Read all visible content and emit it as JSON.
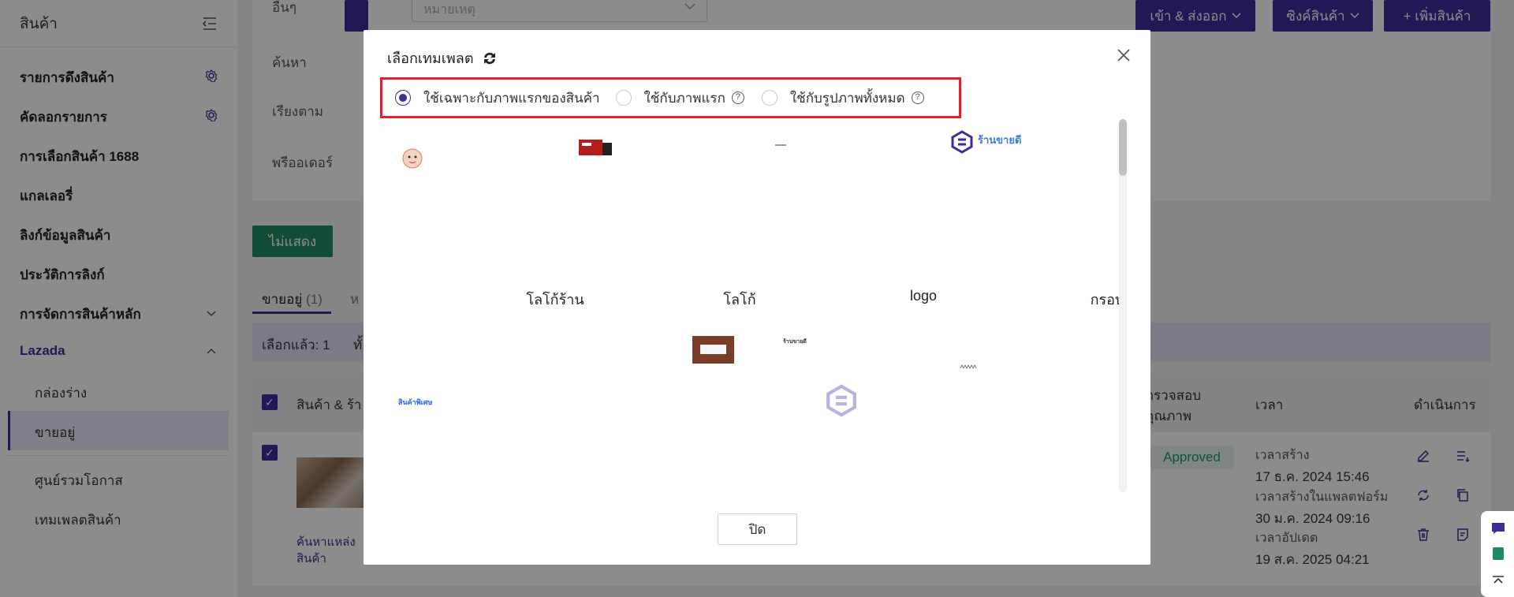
{
  "sidebar": {
    "title": "สินค้า",
    "items": [
      {
        "label": "รายการดึงสินค้า"
      },
      {
        "label": "คัดลอกรายการ"
      },
      {
        "label": "การเลือกสินค้า 1688"
      },
      {
        "label": "แกลเลอรี่"
      },
      {
        "label": "ลิงก์ข้อมูลสินค้า"
      },
      {
        "label": "ประวัติการลิงก์"
      },
      {
        "label": "การจัดการสินค้าหลัก"
      },
      {
        "label": "Lazada"
      }
    ],
    "sub_items": [
      {
        "label": "กล่องร่าง"
      },
      {
        "label": "ขายอยู่"
      },
      {
        "label": "ศูนย์รวมโอกาส"
      },
      {
        "label": "เทมเพลตสินค้า"
      }
    ]
  },
  "filters": {
    "other_label": "อื่นๆ",
    "other_placeholder": "หมายเหตุ",
    "search_label": "ค้นหา",
    "sort_label": "เรียงตาม",
    "preorder_label": "พรีออเดอร์"
  },
  "toolbar": {
    "hide_label": "ไม่แสดง",
    "import_export_label": "เข้า & ส่งออก",
    "sync_label": "ซิงค์สินค้า",
    "add_label": "+ เพิ่มสินค้า"
  },
  "tabs": {
    "active_label": "ขายอยู่",
    "active_count": "(1)",
    "next_partial": "ห"
  },
  "selection": {
    "text": "เลือกแล้ว: 1",
    "extra": "ทั้"
  },
  "table": {
    "col_product": "สินค้า & ร้า",
    "col_quality": "ตรวจสอบ",
    "col_quality2": "คุณภาพ",
    "col_time": "เวลา",
    "col_action": "ดำเนินการ",
    "row": {
      "source_link": "ค้นหาแหล่ง",
      "source_link2": "สินค้า",
      "status": "Approved",
      "created_label": "เวลาสร้าง",
      "created_value": "17 ธ.ค. 2024 15:46",
      "platform_created_label": "เวลาสร้างในแพลตฟอร์ม",
      "platform_created_value": "30 ม.ค. 2024 09:16",
      "updated_label": "เวลาอัปเดต",
      "updated_value": "19 ส.ค. 2025 04:21"
    }
  },
  "modal": {
    "title": "เลือกเทมเพลต",
    "options": [
      {
        "label": "ใช้เฉพาะกับภาพแรกของสินค้า",
        "selected": true
      },
      {
        "label": "ใช้กับภาพแรก",
        "selected": false
      },
      {
        "label": "ใช้กับรูปภาพทั้งหมด",
        "selected": false
      }
    ],
    "templates_row1": [
      "โลโก้ร้าน",
      "โลโก้",
      "logo",
      "กรอบ"
    ],
    "brand_text": "ร้านขายดี",
    "special_text": "สินค้าพิเศษ",
    "shop_small": "ร้านขายดี",
    "close_label": "ปิด"
  },
  "colors": {
    "accent": "#3f2d9b",
    "green": "#1f8a62",
    "highlight": "#e3202a"
  }
}
